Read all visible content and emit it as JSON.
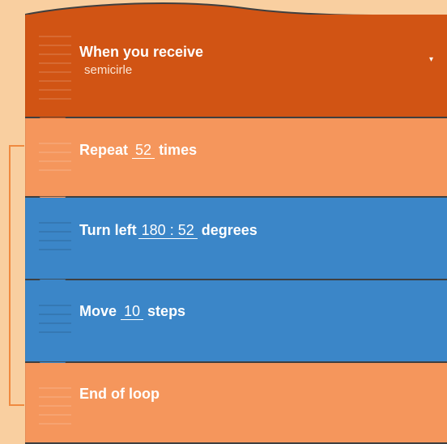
{
  "colors": {
    "background": "#f9cfa0",
    "event_block": "#d15414",
    "control_block": "#f5965c",
    "motion_block": "#3b86c8",
    "loop_bracket": "#f08a40"
  },
  "hat_block": {
    "title": "When you receive",
    "message": "semicirle",
    "dropdown_icon": "▾"
  },
  "repeat_block": {
    "prefix": "Repeat",
    "count": "52",
    "suffix": "times"
  },
  "turn_block": {
    "prefix": "Turn left",
    "angle": "180 : 52",
    "suffix": "degrees"
  },
  "move_block": {
    "prefix": "Move",
    "steps": "10",
    "suffix": "steps"
  },
  "end_block": {
    "label": "End of loop"
  }
}
